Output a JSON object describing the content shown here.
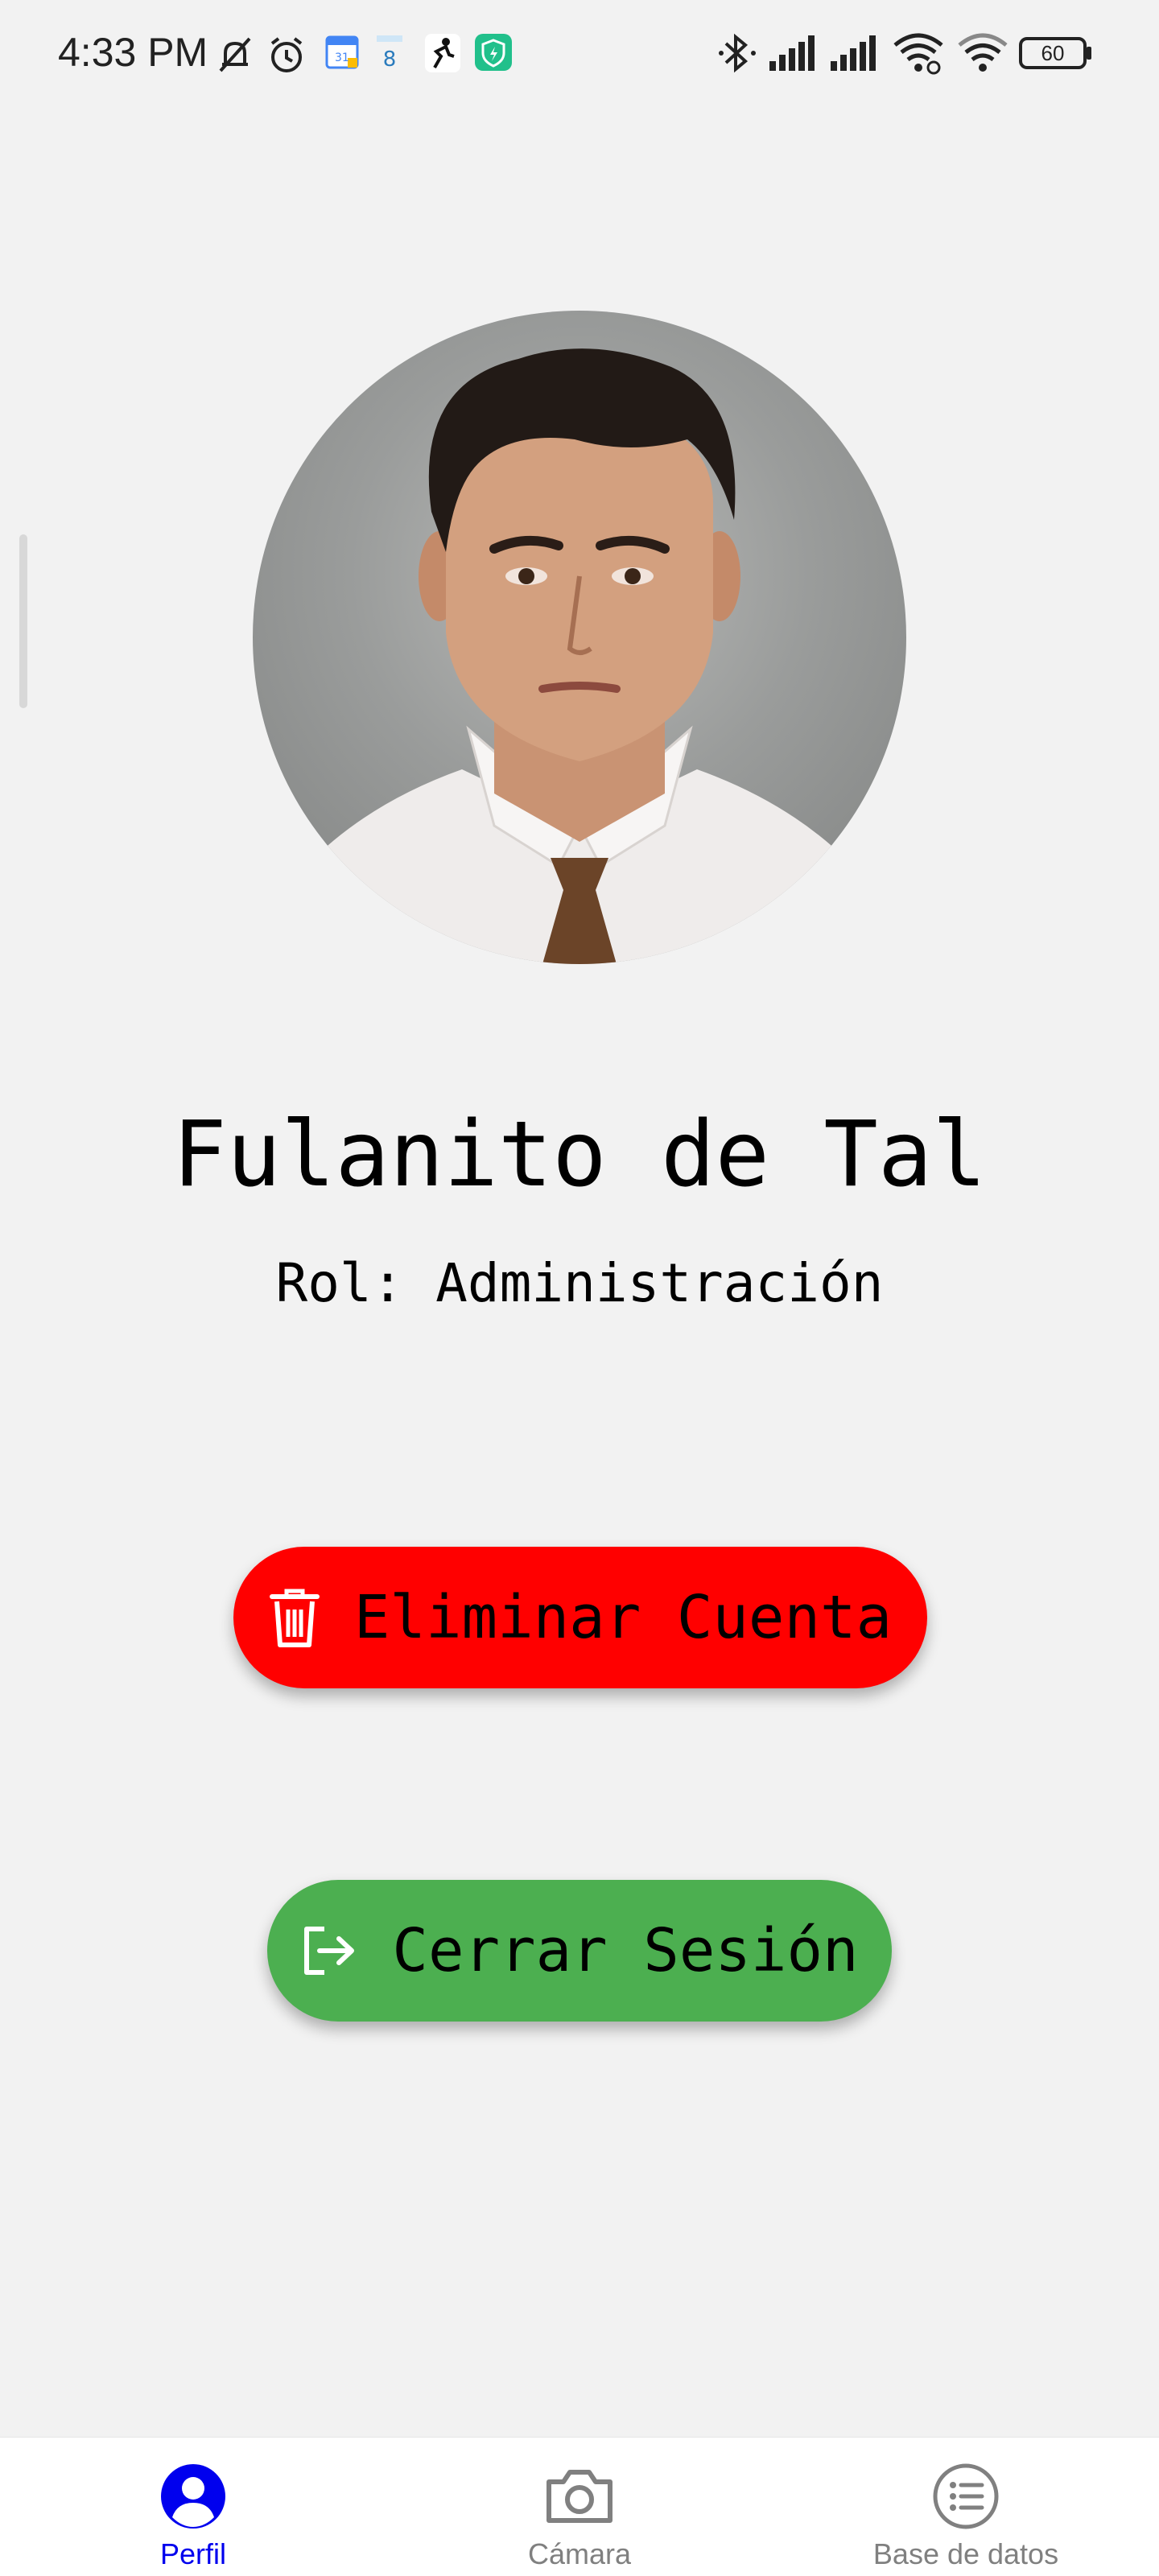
{
  "status_bar": {
    "time": "4:33 PM",
    "left_icons": [
      "bell-muted-icon",
      "alarm-icon",
      "calendar-app-icon",
      "calendar-date-icon",
      "fitness-app-icon",
      "shield-app-icon"
    ],
    "calendar_date_number": "8",
    "right_icons": [
      "bluetooth-icon",
      "signal-icon",
      "signal-icon",
      "wifi-icon",
      "wifi-icon"
    ],
    "battery_level": "60"
  },
  "profile": {
    "name": "Fulanito de Tal",
    "role": "Rol: Administración"
  },
  "actions": {
    "delete_label": "Eliminar Cuenta",
    "logout_label": "Cerrar Sesión"
  },
  "bottom_nav": {
    "items": [
      {
        "label": "Perfil",
        "icon": "person-icon",
        "active": true
      },
      {
        "label": "Cámara",
        "icon": "camera-icon",
        "active": false
      },
      {
        "label": "Base de datos",
        "icon": "list-icon",
        "active": false
      }
    ]
  },
  "colors": {
    "background": "#f2f2f2",
    "delete_button": "#ff0000",
    "logout_button": "#4caf50",
    "nav_active": "#0000ee",
    "nav_inactive": "#808080"
  }
}
